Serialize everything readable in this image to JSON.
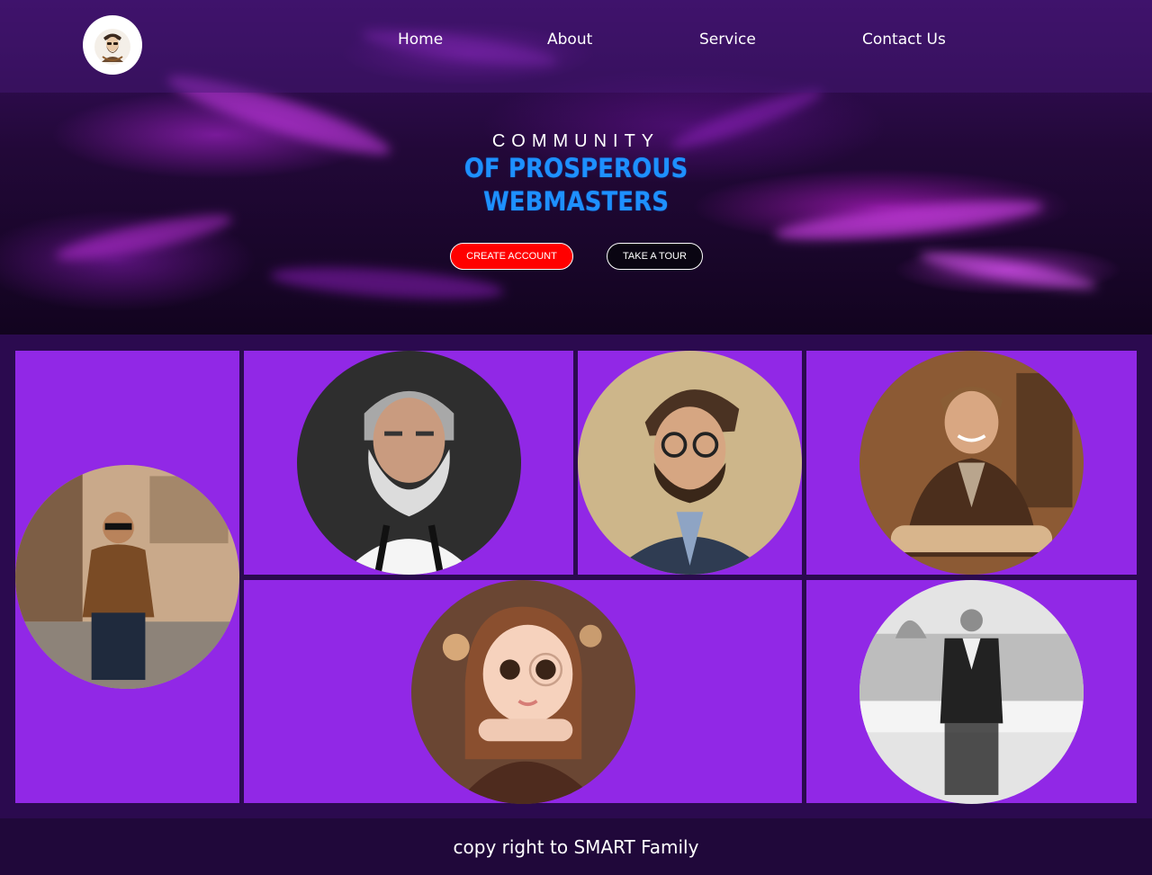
{
  "nav": {
    "logo_icon": "bearded-man-logo-icon",
    "links": [
      "Home",
      "About",
      "Service",
      "Contact Us"
    ]
  },
  "hero": {
    "line1": "COMMUNITY",
    "line2": "OF PROSPEROUS",
    "line3": "WEBMASTERS",
    "create_button": "CREATE ACCOUNT",
    "tour_button": "TAKE A TOUR"
  },
  "gallery": {
    "photos": [
      "man-in-brown-shirt-photo",
      "old-bearded-man-photo",
      "man-with-glasses-photo",
      "man-in-leather-jacket-photo",
      "cartoon-girl-photo",
      "man-in-suit-photo"
    ]
  },
  "footer": {
    "text": "copy right to SMART Family"
  },
  "colors": {
    "tile": "#9128e6",
    "gallery_bg": "#2b0a4f",
    "create_button": "#ff0000",
    "title_blue": "#1e90ff"
  }
}
